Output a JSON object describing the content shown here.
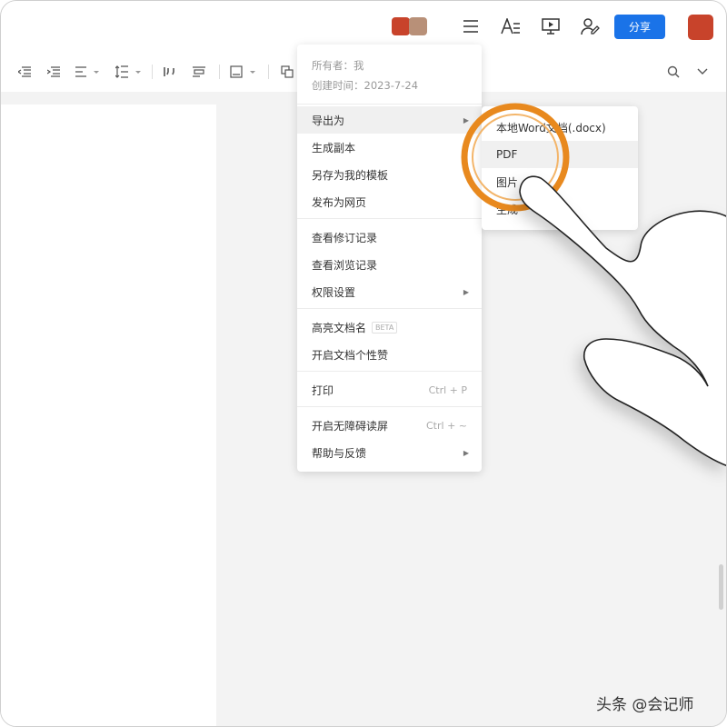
{
  "header": {
    "share_label": "分享",
    "icons": [
      "collaborator-avatars",
      "menu-icon",
      "text-style-icon",
      "present-icon",
      "user-edit-icon",
      "user-avatar"
    ]
  },
  "toolbar": {
    "icons": [
      "indent-decrease-icon",
      "indent-increase-icon",
      "align-icon",
      "line-spacing-icon",
      "quote-icon",
      "block-icon",
      "image-icon",
      "copy-icon",
      "search-icon",
      "collapse-icon"
    ]
  },
  "menu": {
    "owner": "所有者：我",
    "created": "创建时间：2023-7-24",
    "items": [
      {
        "label": "导出为"
      },
      {
        "label": "生成副本"
      },
      {
        "label": "另存为我的模板"
      },
      {
        "label": "发布为网页"
      },
      {
        "label": "查看修订记录"
      },
      {
        "label": "查看浏览记录"
      },
      {
        "label": "权限设置"
      },
      {
        "label": "高亮文档名",
        "badge": "BETA"
      },
      {
        "label": "开启文档个性赞"
      },
      {
        "label": "打印",
        "shortcut": "Ctrl + P"
      },
      {
        "label": "开启无障碍读屏",
        "shortcut": "Ctrl + ~"
      },
      {
        "label": "帮助与反馈"
      }
    ]
  },
  "submenu": {
    "items": [
      {
        "label": "本地Word文档(.docx)"
      },
      {
        "label": "PDF"
      },
      {
        "label": "图片"
      },
      {
        "label": "生成"
      }
    ]
  },
  "watermark": "头条 @会记师",
  "colors": {
    "accent": "#1a73e8",
    "highlight_ring": "#e8891e"
  }
}
